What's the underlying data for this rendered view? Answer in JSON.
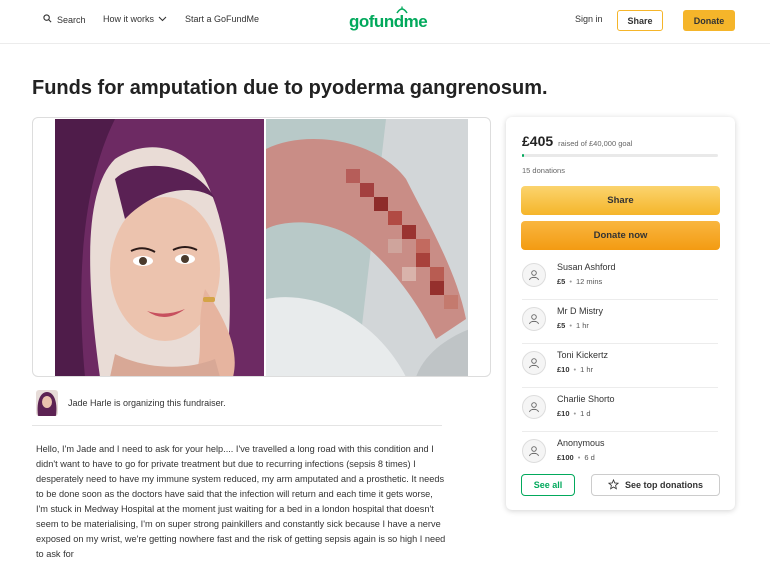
{
  "header": {
    "search_label": "Search",
    "how_it_works_label": "How it works",
    "start_label": "Start a GoFundMe",
    "logo_text": "gofundme",
    "signin_label": "Sign in",
    "share_label": "Share",
    "donate_label": "Donate"
  },
  "campaign": {
    "title": "Funds for amputation due to pyoderma gangrenosum.",
    "organizer_text": "Jade Harle is organizing this fundraiser.",
    "story": "Hello, I'm Jade and I need to ask for your help.... I've travelled a long road with this condition and I didn't want to have to go for private treatment but due to recurring infections (sepsis 8 times) I desperately need to have my immune system reduced, my arm amputated and a prosthetic. It needs to be done soon as the doctors have said that the infection will return and each time it gets worse, I'm stuck in Medway Hospital at the moment just waiting for a bed in a london hospital that doesn't seem to be materialising, I'm on super strong painkillers and constantly sick because I have a nerve exposed on my wrist, we're getting nowhere fast and the risk of getting sepsis again is so high I need to ask for"
  },
  "panel": {
    "raised_amount": "£405",
    "goal_text": "raised of £40,000 goal",
    "progress_fraction": 0.01,
    "donation_count": "15 donations",
    "share_label": "Share",
    "donate_label": "Donate now",
    "donors": [
      {
        "name": "Susan Ashford",
        "amount": "£5",
        "time": "12 mins"
      },
      {
        "name": "Mr D Mistry",
        "amount": "£5",
        "time": "1 hr"
      },
      {
        "name": "Toni Kickertz",
        "amount": "£10",
        "time": "1 hr"
      },
      {
        "name": "Charlie Shorto",
        "amount": "£10",
        "time": "1 d"
      },
      {
        "name": "Anonymous",
        "amount": "£100",
        "time": "6 d"
      }
    ],
    "see_all_label": "See all",
    "top_donations_label": "See top donations"
  },
  "colors": {
    "brand_green": "#02a95c",
    "accent_yellow": "#f5b52a"
  }
}
